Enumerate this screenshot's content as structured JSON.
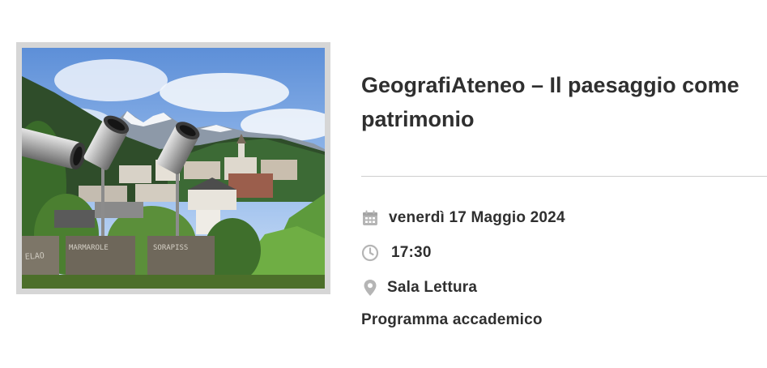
{
  "event": {
    "title": "GeografiAteneo – Il paesaggio come patrimonio",
    "date": "venerdì 17 Maggio 2024",
    "time": "17:30",
    "location": "Sala Lettura",
    "category": "Programma accademico"
  },
  "image": {
    "description": "mountain-village-with-telescopes",
    "sign_texts": [
      "ELAO",
      "MARMAROLE",
      "SORAPISS"
    ]
  },
  "icons": {
    "date": "calendar-icon",
    "time": "clock-icon",
    "location": "map-pin-icon"
  },
  "colors": {
    "text": "#2f2f2f",
    "icon": "#b5b5b5",
    "frame": "#d6d6d6",
    "divider": "#cfcfcf"
  }
}
